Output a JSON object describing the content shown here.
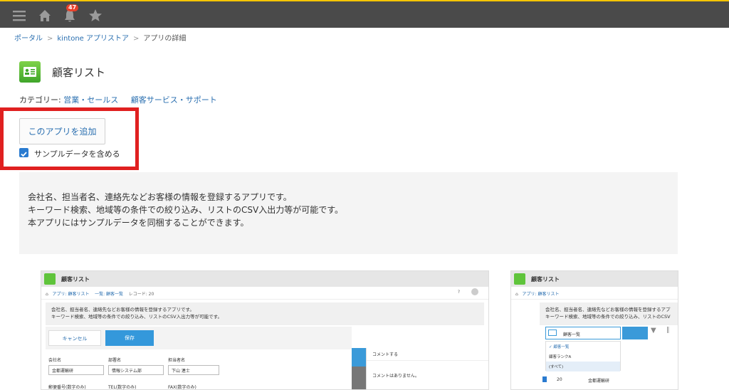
{
  "topbar": {
    "notification_count": "47"
  },
  "breadcrumb": {
    "portal": "ポータル",
    "store": "kintone アプリストア",
    "sep": ">",
    "current": "アプリの詳細"
  },
  "app": {
    "title": "顧客リスト"
  },
  "category": {
    "label": "カテゴリー:",
    "items": [
      "営業・セールス",
      "顧客サービス・サポート"
    ]
  },
  "actions": {
    "add_app": "このアプリを追加",
    "include_sample": "サンプルデータを含める",
    "include_sample_checked": true
  },
  "description": {
    "lines": [
      "会社名、担当者名、連絡先などお客様の情報を登録するアプリです。",
      "キーワード検索、地域等の条件での絞り込み、リストのCSV入出力等が可能です。",
      "本アプリにはサンプルデータを同梱することができます。"
    ]
  },
  "preview1": {
    "title": "顧客リスト",
    "breadcrumb": [
      "アプリ: 顧客リスト",
      "一覧: 顧客一覧",
      "レコード: 20"
    ],
    "desc_lines": [
      "会社名、担当者名、連絡先などお客様の情報を登録するアプリです。",
      "キーワード検索、地域等の条件での絞り込み、リストのCSV入出力等が可能です。"
    ],
    "cancel": "キャンセル",
    "save": "保存",
    "fields": [
      "会社名",
      "部署名",
      "担当者名"
    ],
    "values": [
      "金都運輸研",
      "情報システム部",
      "下山 連士"
    ],
    "fields2": [
      "郵便番号(数字のみ)",
      "TEL(数字のみ)",
      "FAX(数字のみ)"
    ],
    "comment": "コメントする",
    "no_comment": "コメントはありません。"
  },
  "preview2": {
    "title": "顧客リスト",
    "breadcrumb": "アプリ: 顧客リスト",
    "desc_lines": [
      "会社名、担当者名、連絡先などお客様の情報を登録するアプ",
      "キーワード検索、地域等の条件での絞り込み、リストのCSV"
    ],
    "view_select": "顧客一覧",
    "menu": [
      "顧客一覧",
      "顧客ランクA",
      "(すべて)"
    ],
    "row_num": "20",
    "row_company": "金都運輸研"
  }
}
